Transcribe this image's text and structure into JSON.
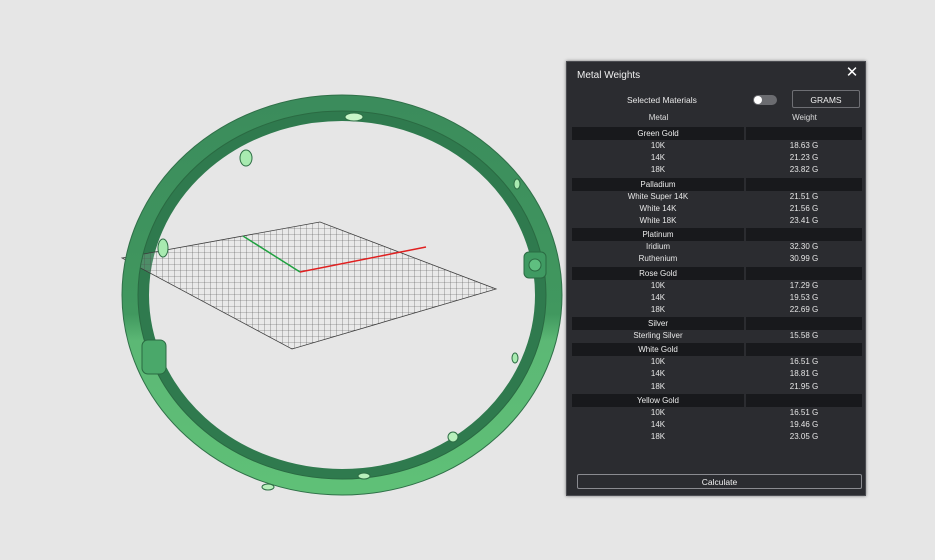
{
  "panel": {
    "title": "Metal Weights",
    "close_icon": "close-icon",
    "selected_materials_label": "Selected Materials",
    "selected_materials_toggle_on": false,
    "units_button": "GRAMS",
    "columns": {
      "metal": "Metal",
      "weight": "Weight"
    },
    "groups": [
      {
        "name": "Green Gold",
        "items": [
          {
            "metal": "10K",
            "weight": "18.63 G"
          },
          {
            "metal": "14K",
            "weight": "21.23 G"
          },
          {
            "metal": "18K",
            "weight": "23.82 G"
          }
        ]
      },
      {
        "name": "Palladium",
        "items": [
          {
            "metal": "White Super 14K",
            "weight": "21.51 G"
          },
          {
            "metal": "White 14K",
            "weight": "21.56 G"
          },
          {
            "metal": "White 18K",
            "weight": "23.41 G"
          }
        ]
      },
      {
        "name": "Platinum",
        "items": [
          {
            "metal": "Iridium",
            "weight": "32.30 G"
          },
          {
            "metal": "Ruthenium",
            "weight": "30.99 G"
          }
        ]
      },
      {
        "name": "Rose Gold",
        "items": [
          {
            "metal": "10K",
            "weight": "17.29 G"
          },
          {
            "metal": "14K",
            "weight": "19.53 G"
          },
          {
            "metal": "18K",
            "weight": "22.69 G"
          }
        ]
      },
      {
        "name": "Silver",
        "items": [
          {
            "metal": "Sterling Silver",
            "weight": "15.58 G"
          }
        ]
      },
      {
        "name": "White Gold",
        "items": [
          {
            "metal": "10K",
            "weight": "16.51 G"
          },
          {
            "metal": "14K",
            "weight": "18.81 G"
          },
          {
            "metal": "18K",
            "weight": "21.95 G"
          }
        ]
      },
      {
        "name": "Yellow Gold",
        "items": [
          {
            "metal": "10K",
            "weight": "16.51 G"
          },
          {
            "metal": "14K",
            "weight": "19.46 G"
          },
          {
            "metal": "18K",
            "weight": "23.05 G"
          }
        ]
      }
    ],
    "calculate_button": "Calculate"
  },
  "viewport": {
    "background": "#e6e6e6",
    "ring_color": "#3d8f60",
    "axis_x_color": "#e02020",
    "axis_y_color": "#20a040"
  }
}
